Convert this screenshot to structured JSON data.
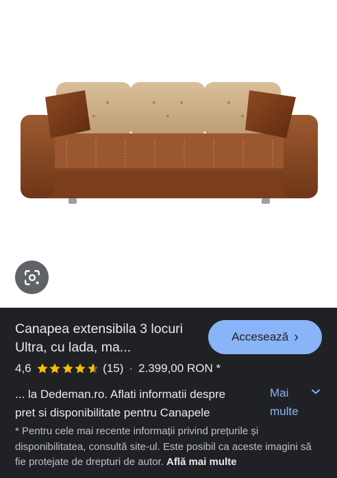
{
  "product": {
    "image_alt": "Canapea extensibila maro cu perne bej",
    "title": "Canapea extensibila 3 locuri Ultra, cu lada, ma...",
    "rating": "4,6",
    "rating_stars": 4.6,
    "review_count": "(15)",
    "separator": "·",
    "price": "2.399,00 RON *",
    "description": "... la Dedeman.ro. Aflati informatii despre pret si disponibilitate pentru Canapele",
    "more_label": "Mai multe"
  },
  "buttons": {
    "visit_label": "Accesează",
    "visit_chevron": "›",
    "lens_icon": "google-lens-icon",
    "expand_icon": "chevron-down-icon"
  },
  "disclaimer": {
    "text": "* Pentru cele mai recente informații privind prețurile și disponibilitatea, consultă site-ul. Este posibil ca aceste imagini să fie protejate de drepturi de autor.",
    "learn_more": "Află mai multe"
  },
  "colors": {
    "panel_bg": "#202124",
    "accent": "#8ab4f8",
    "star": "#fbbc04",
    "sofa_leather": "#8b4a24",
    "cushion": "#c9ab86"
  }
}
